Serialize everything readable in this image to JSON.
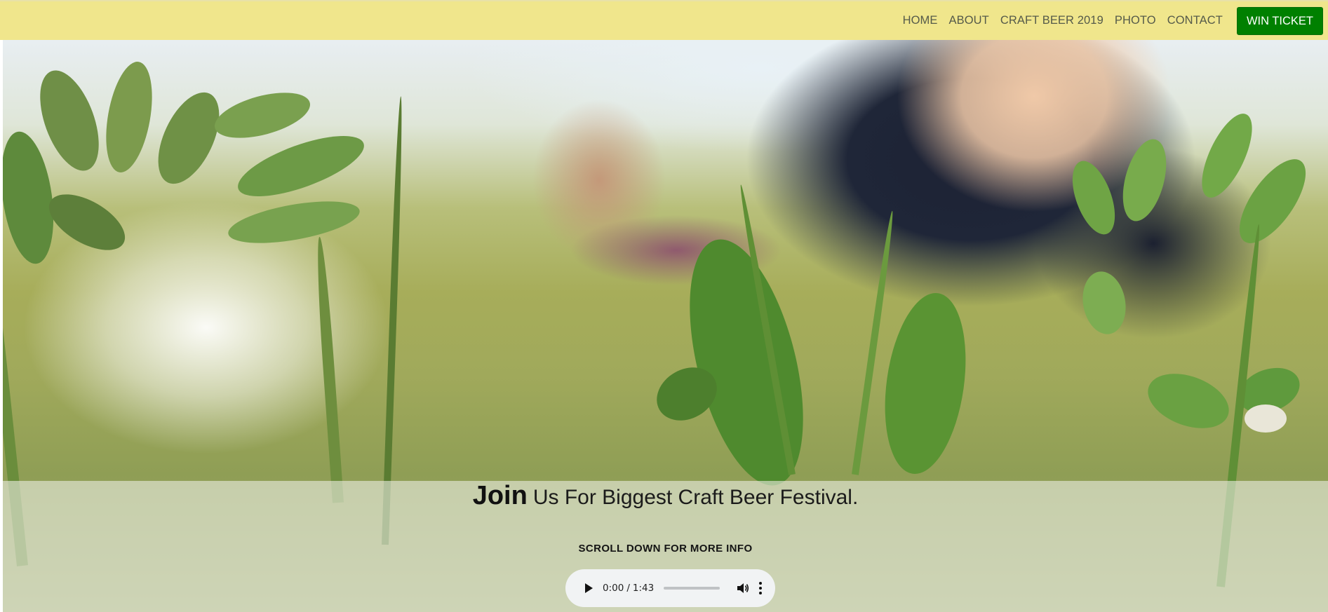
{
  "nav": {
    "links": [
      "HOME",
      "ABOUT",
      "CRAFT BEER 2019",
      "PHOTO",
      "CONTACT"
    ],
    "cta": "WIN TICKET"
  },
  "hero": {
    "title_strong": "Join",
    "title_rest": "Us For Biggest Craft Beer Festival.",
    "scroll_hint": "SCROLL DOWN FOR MORE INFO"
  },
  "audio": {
    "current_time": "0:00",
    "separator": "/",
    "duration": "1:43",
    "progress": 0.0
  },
  "colors": {
    "navbar_bg": "#f0e68c",
    "cta_bg": "#008000",
    "cta_text": "#ffffff",
    "player_bg": "#f1f3f4"
  },
  "icons": [
    "play-icon",
    "volume-icon",
    "more-options-icon"
  ]
}
